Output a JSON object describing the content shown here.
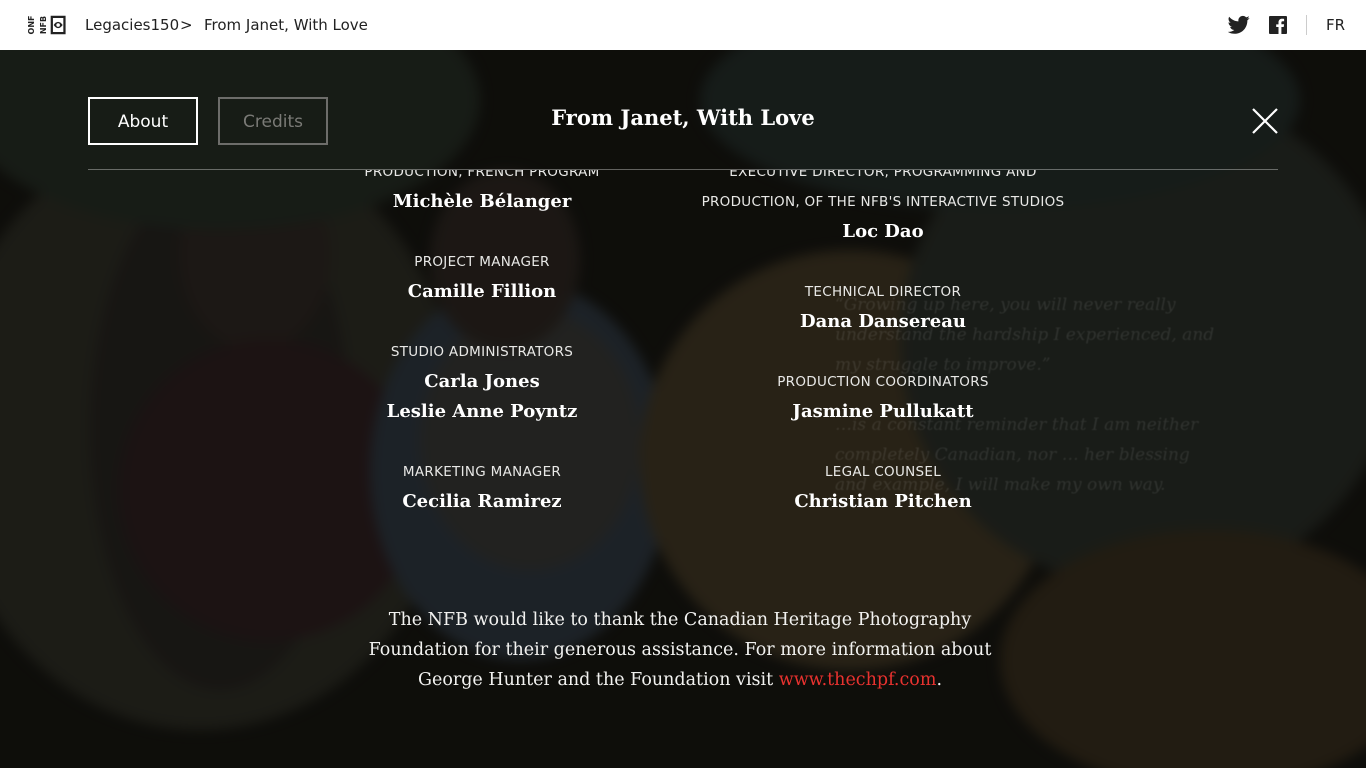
{
  "header": {
    "logo_text_1": "ONF",
    "logo_text_2": "NFB",
    "breadcrumb": [
      "Legacies150",
      "From Janet, With Love"
    ],
    "breadcrumb_separator": ">",
    "language": "FR"
  },
  "modal": {
    "tabs": [
      {
        "label": "About",
        "active": true
      },
      {
        "label": "Credits",
        "active": false
      }
    ],
    "title": "From Janet, With Love"
  },
  "background_quote": {
    "line_1": "“Growing up here, you will never really understand the hardship I experienced, and my struggle to improve.”",
    "line_2": "…is a constant reminder that I am neither completely Canadian, nor … her blessing and example, I will make my own way."
  },
  "credits": {
    "left": [
      {
        "role": "Production, French Program",
        "names": [
          "Michèle Bélanger"
        ]
      },
      {
        "role": "Project Manager",
        "names": [
          "Camille Fillion"
        ]
      },
      {
        "role": "Studio Administrators",
        "names": [
          "Carla Jones",
          "Leslie Anne Poyntz"
        ]
      },
      {
        "role": "Marketing Manager",
        "names": [
          "Cecilia Ramirez"
        ]
      }
    ],
    "right": [
      {
        "role_lines": [
          "Executive Director, Programming and",
          "Production, of the NFB's Interactive Studios"
        ],
        "names": [
          "Loc Dao"
        ]
      },
      {
        "role": "Technical Director",
        "names": [
          "Dana Dansereau"
        ]
      },
      {
        "role": "Production Coordinators",
        "names": [
          "Jasmine Pullukatt"
        ]
      },
      {
        "role": "Legal Counsel",
        "names": [
          "Christian Pitchen"
        ]
      }
    ]
  },
  "thanks": {
    "text": "The NFB would like to thank the Canadian Heritage Photography Foundation for their generous assistance. For more information about George Hunter and the Foundation visit ",
    "link_text": "www.thechpf.com",
    "end": "."
  },
  "colors": {
    "link": "#e8322f",
    "text": "#ffffff",
    "topbar": "#ffffff"
  }
}
